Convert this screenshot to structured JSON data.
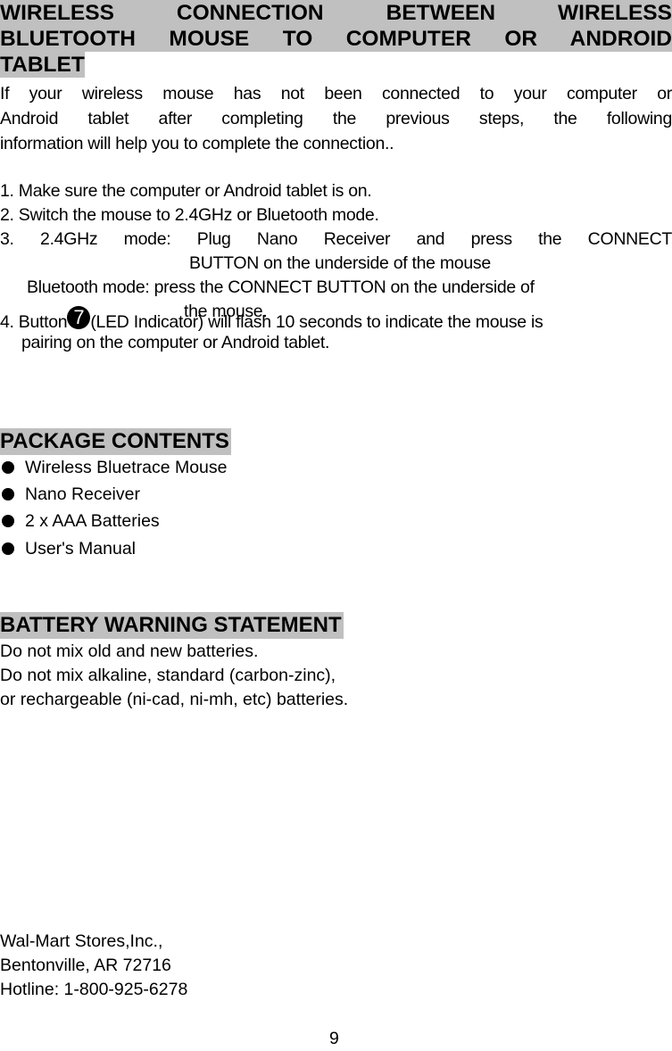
{
  "section1": {
    "title_lines": [
      "WIRELESS CONNECTION BETWEEN WIRELESS",
      "BLUETOOTH MOUSE TO COMPUTER OR ANDROID",
      "TABLET"
    ],
    "intro_lines": [
      "If your wireless mouse has not been connected to your computer or",
      "Android tablet after completing the previous steps, the following",
      "information will help you to complete the connection.."
    ],
    "steps": {
      "s1": "1. Make sure the computer or Android tablet is on.",
      "s2": "2. Switch the mouse to 2.4GHz or Bluetooth mode.",
      "s3_line1": "3. 2.4GHz mode: Plug Nano Receiver and press the CONNECT",
      "s3_line2": "BUTTON on the underside of the mouse",
      "s3_line3": "Bluetooth mode: press the CONNECT BUTTON on the underside of",
      "s3_line4": "the mouse.",
      "s4_prefix": "4. Button",
      "s4_badge": "7",
      "s4_suffix": "(LED Indicator) will flash 10 seconds to indicate the mouse is",
      "s4_line2": "pairing on the computer or Android tablet."
    }
  },
  "package": {
    "title": "PACKAGE CONTENTS",
    "items": [
      "Wireless Bluetrace Mouse",
      "Nano Receiver",
      "2 x AAA Batteries",
      "User's Manual"
    ]
  },
  "battery": {
    "title": "BATTERY WARNING STATEMENT",
    "lines": [
      "Do not mix old and new batteries.",
      "Do not mix alkaline, standard (carbon-zinc),",
      "or rechargeable (ni-cad, ni-mh, etc) batteries."
    ]
  },
  "footer": {
    "company": "Wal-Mart Stores,Inc.,",
    "address": "Bentonville, AR 72716",
    "hotline": "Hotline: 1-800-925-6278",
    "page_number": "9"
  }
}
